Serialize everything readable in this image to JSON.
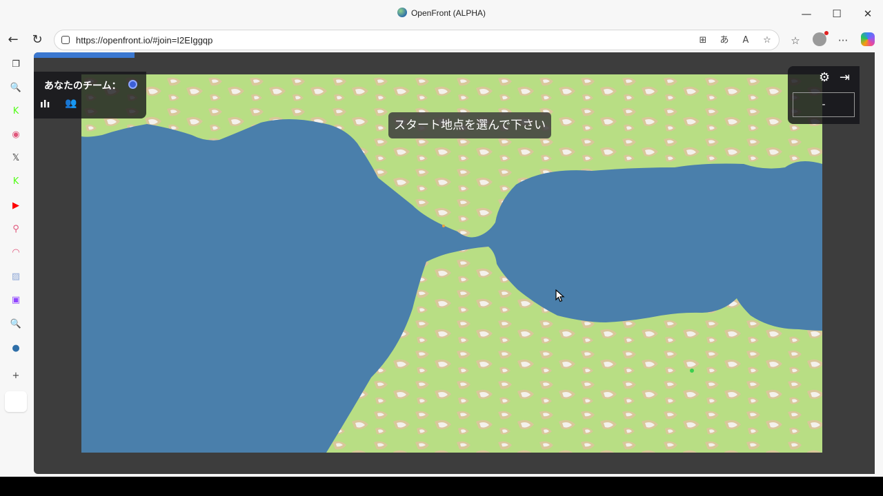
{
  "window": {
    "title": "OpenFront (ALPHA)",
    "controls": {
      "minimize": "—",
      "maximize": "☐",
      "close": "✕"
    }
  },
  "nav": {
    "url": "https://openfront.io/#join=I2EIggqp",
    "back": "←",
    "reload": "↻"
  },
  "toolbar": {
    "split_icon": "⊞",
    "translate_icon": "あ",
    "read_aloud_icon": "A",
    "favorite_icon": "☆",
    "favorites_icon": "☆",
    "more_icon": "···"
  },
  "sidebar": {
    "items": [
      {
        "icon": "tabs-icon",
        "glyph": "❐",
        "color": "#333333"
      },
      {
        "icon": "search-icon",
        "glyph": "🔍",
        "color": "#6b8fd6"
      },
      {
        "icon": "kick-icon",
        "glyph": "K",
        "color": "#53fc18"
      },
      {
        "icon": "circle-app-icon",
        "glyph": "◉",
        "color": "#e0557a"
      },
      {
        "icon": "x-icon",
        "glyph": "𝕏",
        "color": "#333333"
      },
      {
        "icon": "kick-icon-2",
        "glyph": "K",
        "color": "#53fc18"
      },
      {
        "icon": "youtube-icon",
        "glyph": "▶",
        "color": "#ff0000"
      },
      {
        "icon": "maps-icon",
        "glyph": "⚲",
        "color": "#e0557a"
      },
      {
        "icon": "speed-icon",
        "glyph": "◠",
        "color": "#e0557a"
      },
      {
        "icon": "image-app-icon",
        "glyph": "▨",
        "color": "#8fa8d6"
      },
      {
        "icon": "twitch-icon",
        "glyph": "▣",
        "color": "#9146ff"
      },
      {
        "icon": "search-icon-2",
        "glyph": "🔍",
        "color": "#6b8fd6"
      },
      {
        "icon": "openfront-icon",
        "glyph": "●",
        "color": "#2f6fa8"
      },
      {
        "icon": "add-icon",
        "glyph": "+",
        "color": "#444444"
      }
    ]
  },
  "game": {
    "team_label": "あなたのチーム：",
    "team_color": "#3b5fd6",
    "stats_icon": "ılı",
    "players_icon": "👥",
    "settings_icon": "⚙",
    "exit_icon": "⇥",
    "status_value": "-",
    "toast": "スタート地点を選んで下さい",
    "progress_fraction": 0.12
  },
  "colors": {
    "sea": "#4a7fab",
    "land": "#b8de84",
    "hills": "#d9c79a",
    "mountain": "#f4f1ec"
  }
}
